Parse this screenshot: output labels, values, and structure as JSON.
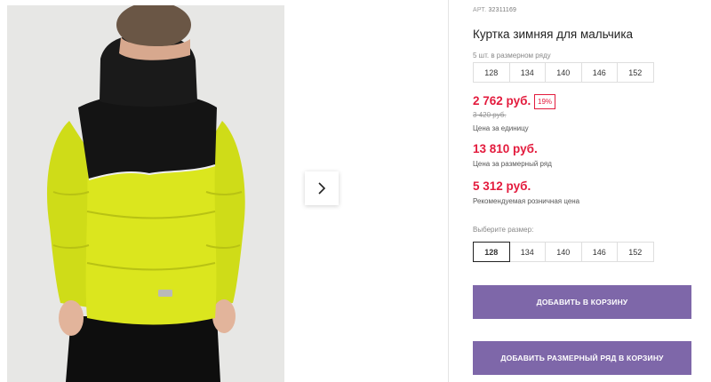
{
  "gallery": {
    "next_icon": "chevron-right-icon"
  },
  "product": {
    "article_label": "АРТ.",
    "article_number": "32311169",
    "title": "Куртка зимняя для мальчика",
    "pack_label": "5 шт. в размерном ряду",
    "pack_sizes": [
      "128",
      "134",
      "140",
      "146",
      "152"
    ],
    "unit_price": "2 762 руб.",
    "discount": "19%",
    "old_price": "3 420 руб.",
    "unit_price_caption": "Цена за единицу",
    "pack_price": "13 810 руб.",
    "pack_price_caption": "Цена за размерный ряд",
    "retail_price": "5 312 руб.",
    "retail_price_caption": "Рекомендуемая розничная цена",
    "choose_size_label": "Выберите размер:",
    "sizes": [
      "128",
      "134",
      "140",
      "146",
      "152"
    ],
    "selected_size": "128"
  },
  "actions": {
    "add_to_cart": "ДОБАВИТЬ В КОРЗИНУ",
    "add_pack_to_cart": "ДОБАВИТЬ РАЗМЕРНЫЙ РЯД В КОРЗИНУ"
  },
  "colors": {
    "price_red": "#e31b3d",
    "button_purple": "#7e67a9",
    "jacket_lime": "#d6e31c",
    "jacket_black": "#141414"
  }
}
